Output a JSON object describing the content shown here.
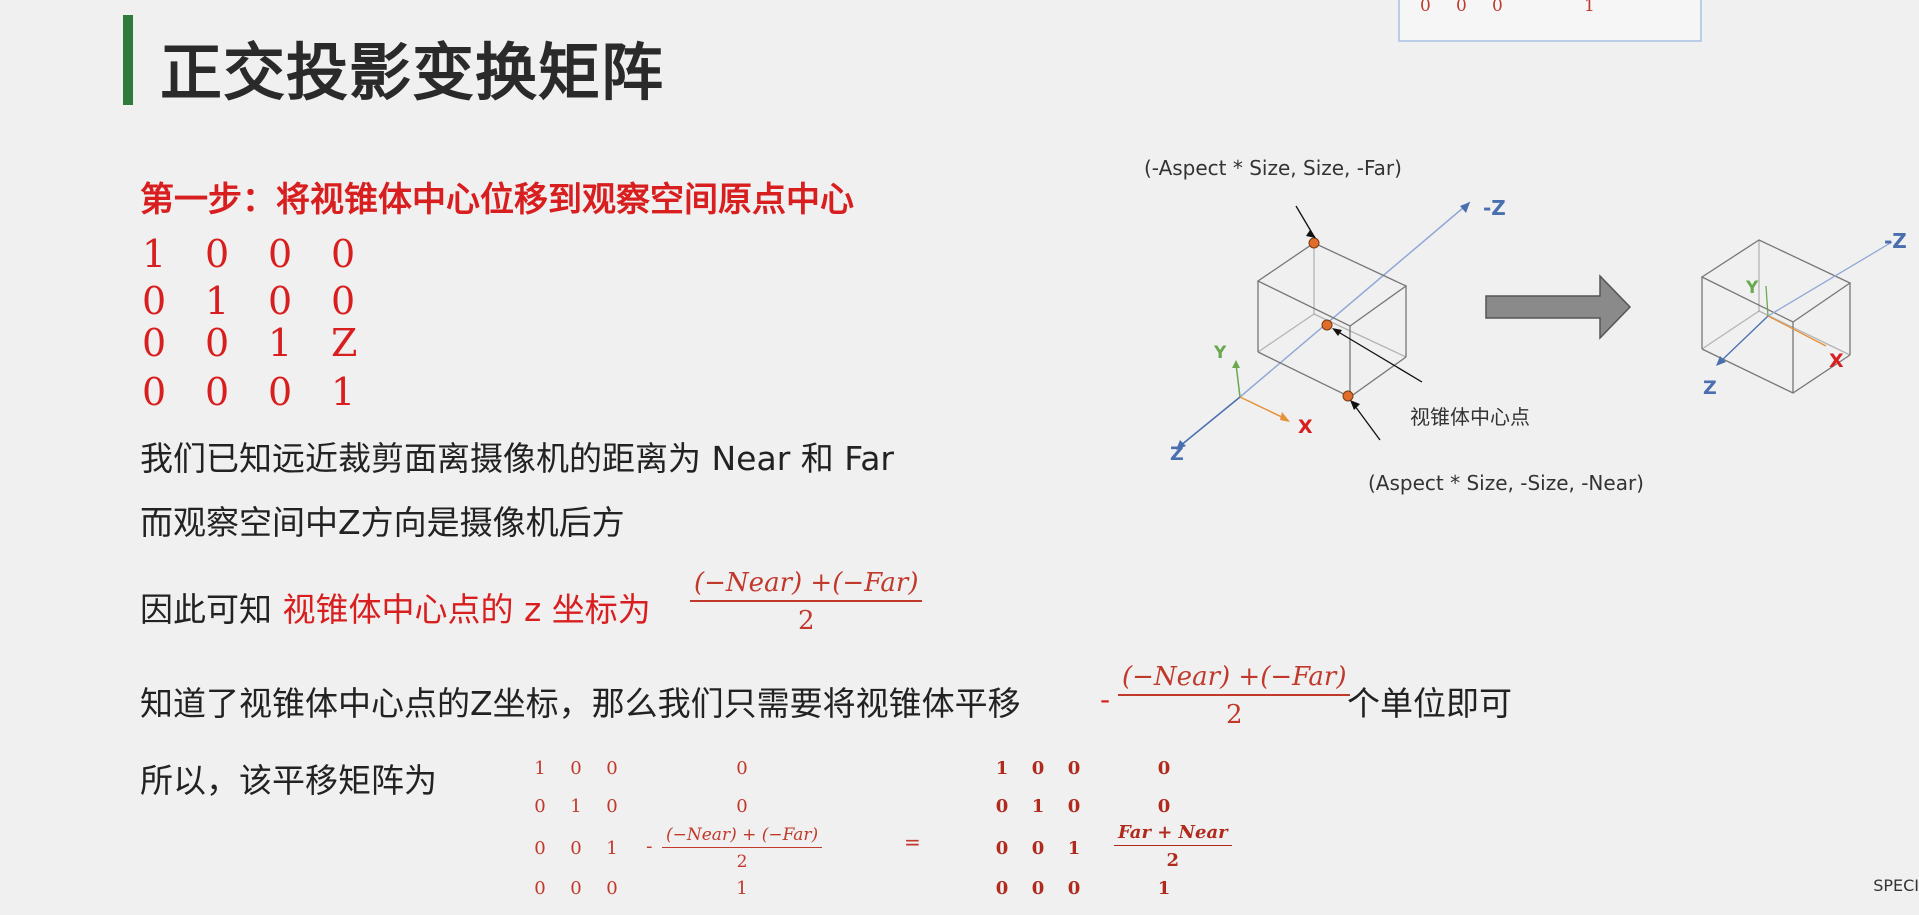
{
  "title": "正交投影变换矩阵",
  "corner_matrix_row": [
    "0",
    "0",
    "0",
    "1"
  ],
  "step1": "第一步：将视锥体中心位移到观察空间原点中心",
  "matrix_big": [
    [
      "1",
      "0",
      "0",
      "0"
    ],
    [
      "0",
      "1",
      "0",
      "0"
    ],
    [
      "0",
      "0",
      "1",
      "Z"
    ],
    [
      "0",
      "0",
      "0",
      "1"
    ]
  ],
  "line1": "我们已知远近裁剪面离摄像机的距离为 Near 和 Far",
  "line2": "而观察空间中Z方向是摄像机后方",
  "line3_prefix": "因此可知 ",
  "line3_red": "视锥体中心点的 z 坐标为",
  "frac_main": {
    "num": "(−Near) +(−Far)",
    "den": "2"
  },
  "line4_prefix": "知道了视锥体中心点的Z坐标，那么我们只需要将视锥体平移",
  "line4_minus": "-",
  "line4_suffix": "个单位即可",
  "line5": "所以，该平移矩阵为",
  "matrix_left": [
    [
      "1",
      "0",
      "0",
      "0"
    ],
    [
      "0",
      "1",
      "0",
      "0"
    ],
    [
      "0",
      "0",
      "1",
      ""
    ],
    [
      "0",
      "0",
      "0",
      "1"
    ]
  ],
  "matrix_left_minus": "-",
  "frac_left": {
    "num": "(−Near) + (−Far)",
    "den": "2"
  },
  "equals": "=",
  "matrix_right": [
    [
      "1",
      "0",
      "0",
      "0"
    ],
    [
      "0",
      "1",
      "0",
      "0"
    ],
    [
      "0",
      "0",
      "1",
      ""
    ],
    [
      "0",
      "0",
      "0",
      "1"
    ]
  ],
  "frac_right": {
    "num": "Far + Near",
    "den": "2"
  },
  "diagram": {
    "top_label": "(-Aspect * Size, Size,  -Far)",
    "bottom_label": "(Aspect * Size, -Size,  -Near)",
    "center_label": "视锥体中心点",
    "axis_z_neg": "-Z",
    "axis_y": "Y",
    "axis_x": "X",
    "axis_z": "Z",
    "axis_z_neg_right": "-Z",
    "axis_y_right": "Y",
    "axis_x_right": "X",
    "axis_z_right": "Z"
  },
  "corner_text": "SPECI",
  "colors": {
    "accent_red": "#d81e1e",
    "title_bar": "#2f7a3a",
    "axis_blue": "#4a6fb0",
    "axis_green": "#6aa84f",
    "axis_orange": "#e69138"
  }
}
